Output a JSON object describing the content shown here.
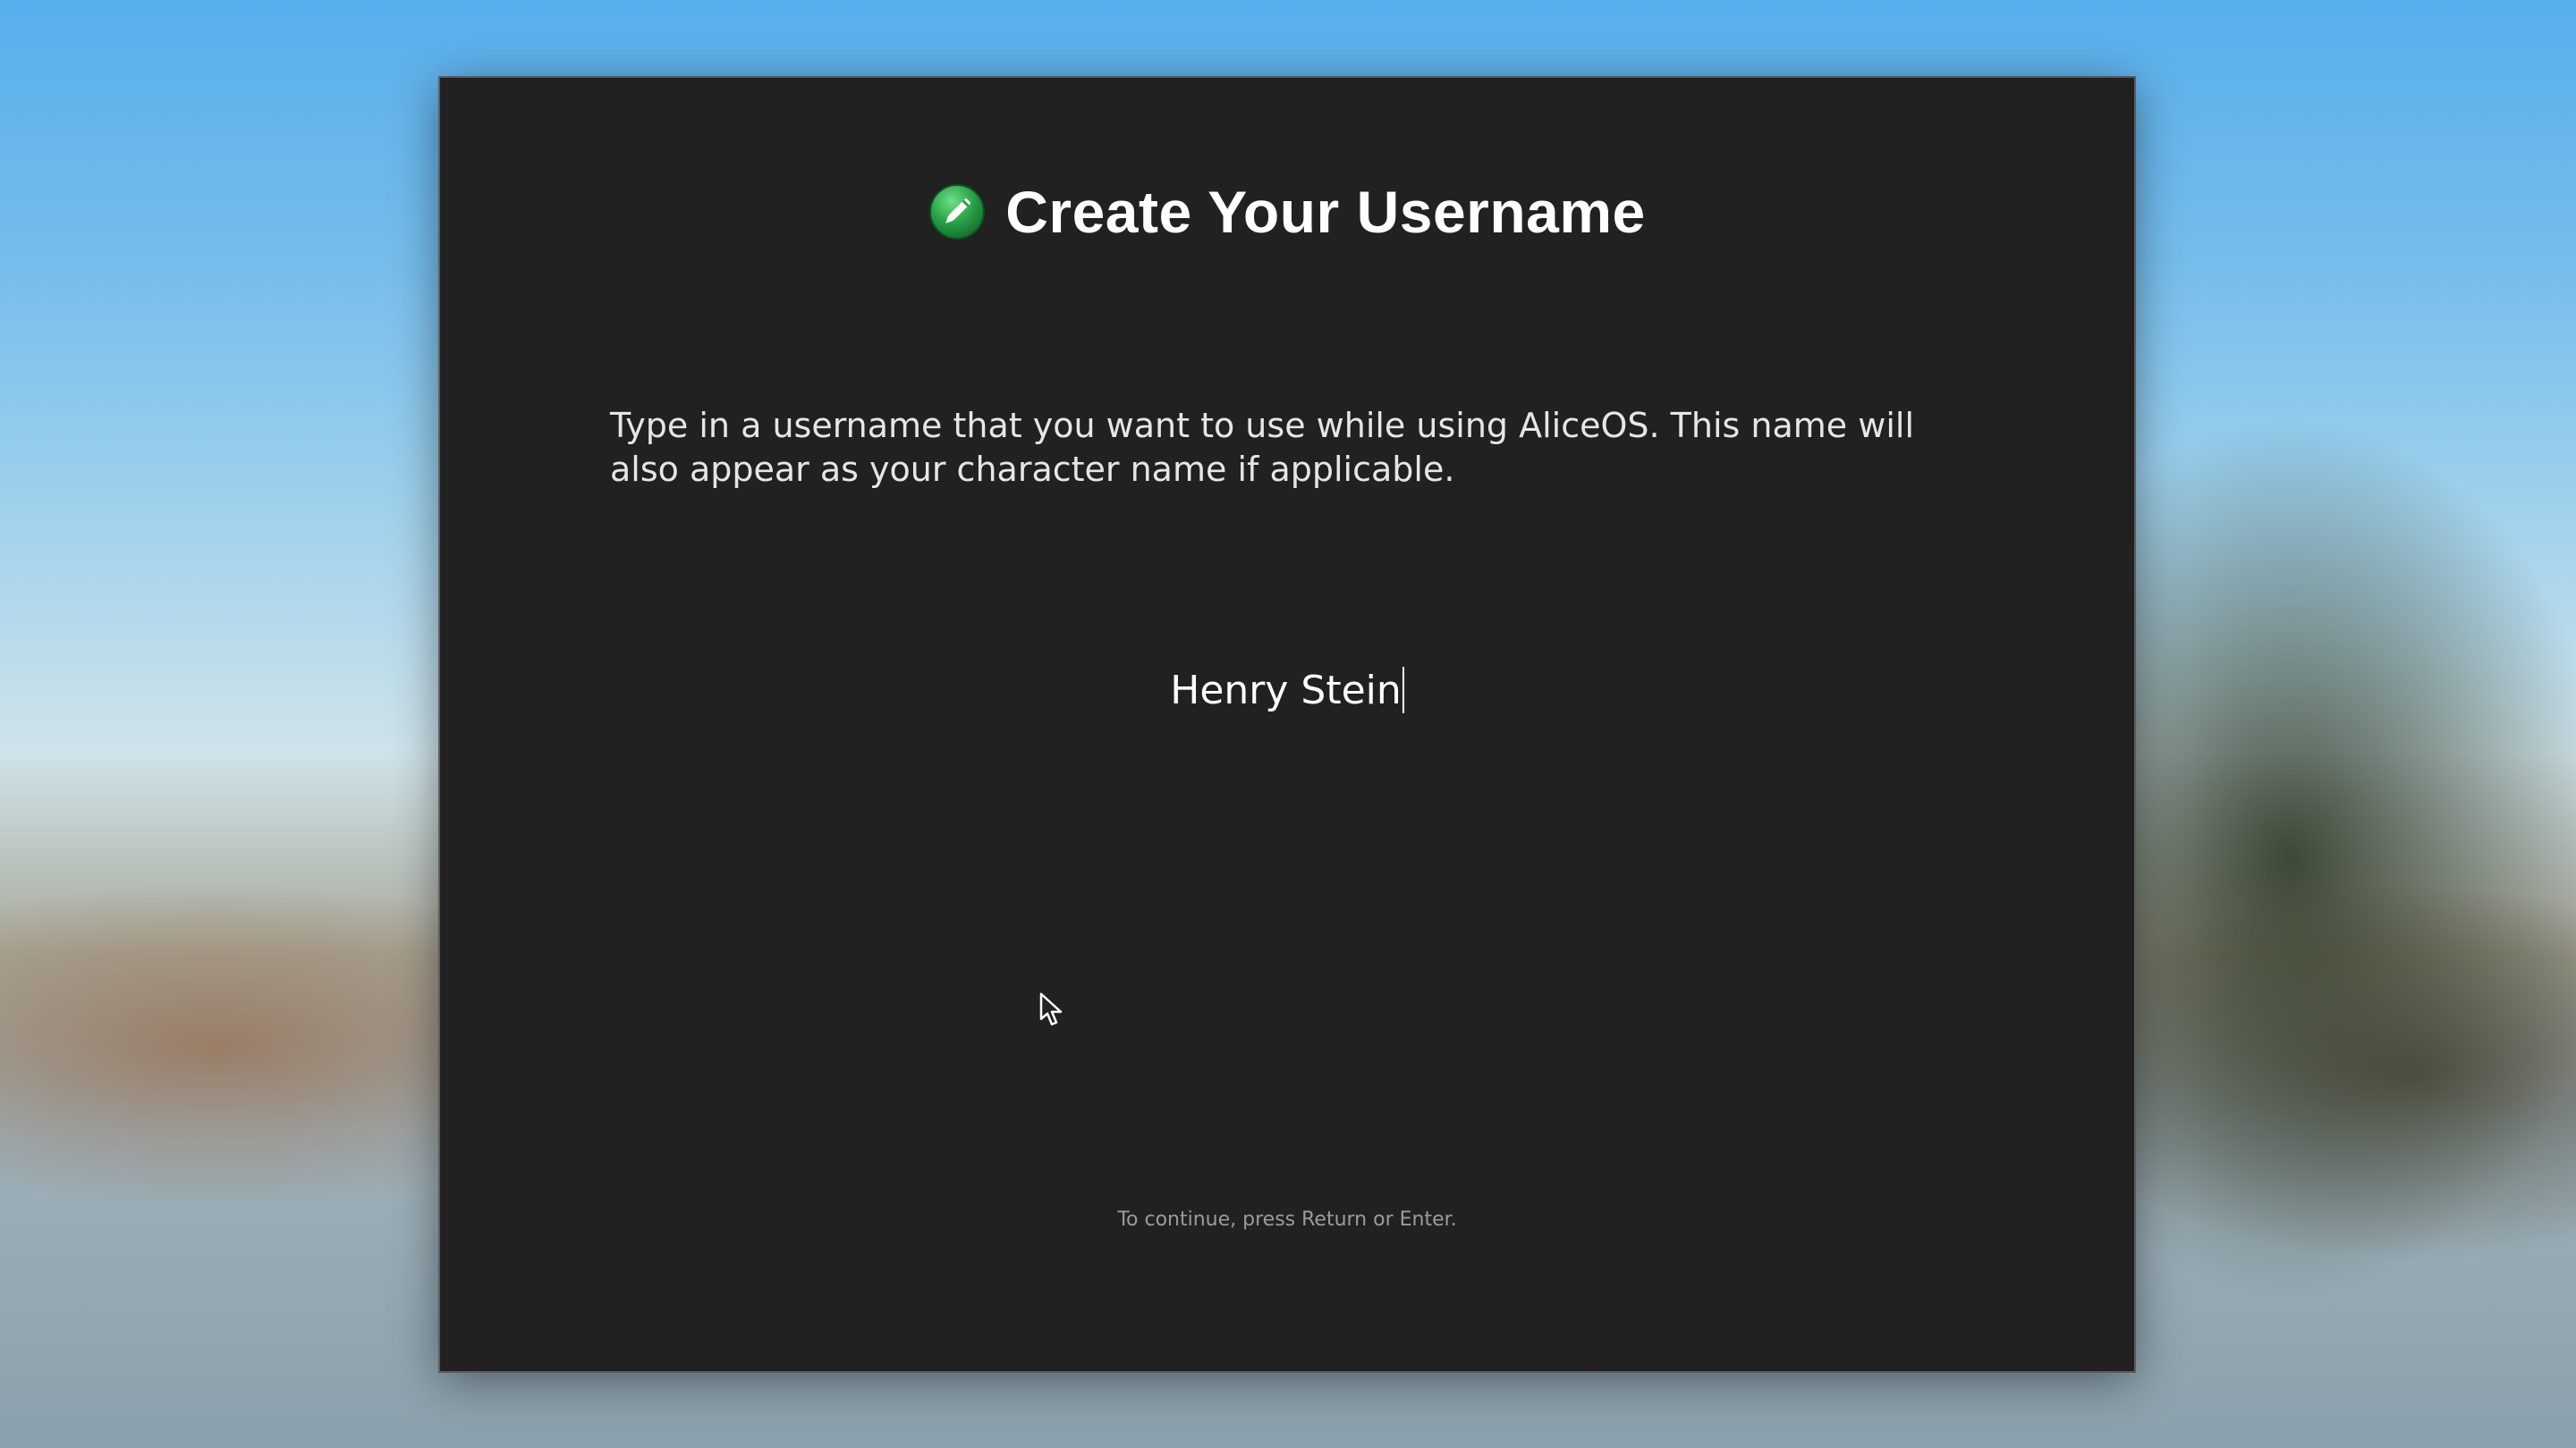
{
  "screen": {
    "title": "Create Your Username",
    "title_icon": "pencil-icon",
    "description": "Type in a username that you want to use while using AliceOS. This name will also appear as your character name if applicable.",
    "username_value": "Henry Stein",
    "hint": "To continue, press Return or Enter.",
    "colors": {
      "dialog_background": "#212121",
      "icon_green": "#27a046",
      "text": "#ffffff",
      "hint_text": "#9b9b9b"
    }
  }
}
